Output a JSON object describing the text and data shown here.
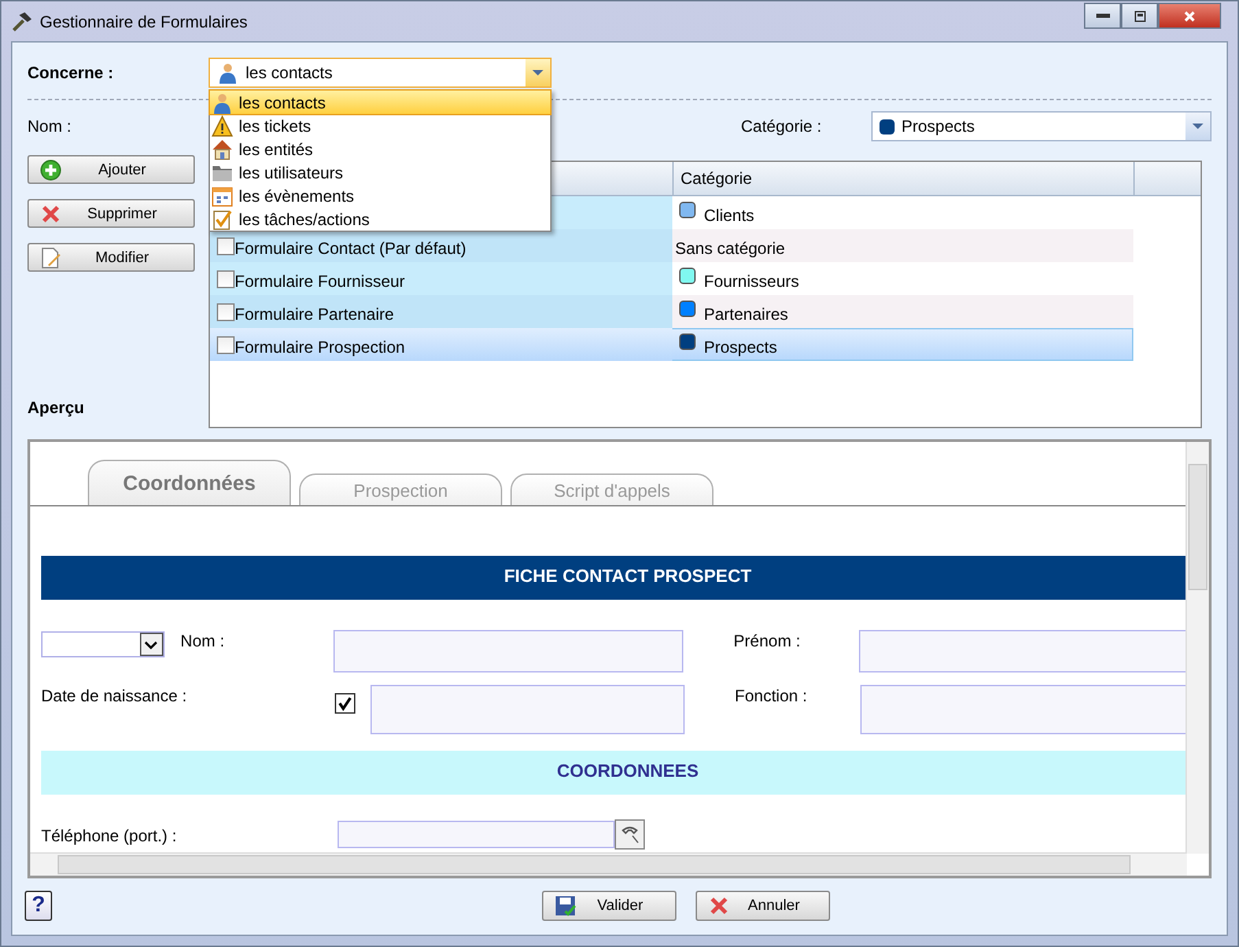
{
  "window": {
    "title": "Gestionnaire de Formulaires"
  },
  "concerne": {
    "label": "Concerne :",
    "value": "les contacts",
    "options": [
      {
        "label": "les contacts",
        "kind": "person",
        "selected": true
      },
      {
        "label": "les tickets",
        "kind": "warning",
        "selected": false
      },
      {
        "label": "les entités",
        "kind": "house",
        "selected": false
      },
      {
        "label": "les utilisateurs",
        "kind": "folder",
        "selected": false
      },
      {
        "label": "les évènements",
        "kind": "calendar",
        "selected": false
      },
      {
        "label": "les tâches/actions",
        "kind": "task",
        "selected": false
      }
    ]
  },
  "nom": {
    "label": "Nom :"
  },
  "categorie": {
    "label": "Catégorie :",
    "value": "Prospects",
    "color": "#003f80"
  },
  "actions": [
    {
      "label": "Ajouter",
      "kind": "add"
    },
    {
      "label": "Supprimer",
      "kind": "delete"
    },
    {
      "label": "Modifier",
      "kind": "edit"
    }
  ],
  "table": {
    "column_2": "Catégorie",
    "rows": [
      {
        "category": "Clients",
        "color": "#80b8f0",
        "selected": false
      },
      {
        "name": "Formulaire Contact (Par défaut)",
        "checked": false,
        "category": "Sans catégorie",
        "selected": false
      },
      {
        "name": "Formulaire Fournisseur",
        "checked": false,
        "category": "Fournisseurs",
        "color": "#80f8f0",
        "selected": false
      },
      {
        "name": "Formulaire Partenaire",
        "checked": false,
        "category": "Partenaires",
        "color": "#0080ff",
        "selected": false
      },
      {
        "name": "Formulaire Prospection",
        "checked": false,
        "category": "Prospects",
        "color": "#003f80",
        "selected": true
      }
    ]
  },
  "preview": {
    "label": "Aperçu",
    "tabs": [
      {
        "label": "Coordonnées",
        "selected": true
      },
      {
        "label": "Prospection",
        "selected": false
      },
      {
        "label": "Script d'appels",
        "selected": false
      }
    ],
    "header": "FICHE CONTACT PROSPECT",
    "nom_label": "Nom :",
    "prenom_label": "Prénom :",
    "birth_label": "Date de naissance :",
    "birth_checked": true,
    "fonction_label": "Fonction :",
    "section": "COORDONNEES",
    "phone_label": "Téléphone (port.) :"
  },
  "footer": {
    "help": "?",
    "buttons": [
      {
        "label": "Valider",
        "kind": "save"
      },
      {
        "label": "Annuler",
        "kind": "cancel"
      }
    ]
  }
}
